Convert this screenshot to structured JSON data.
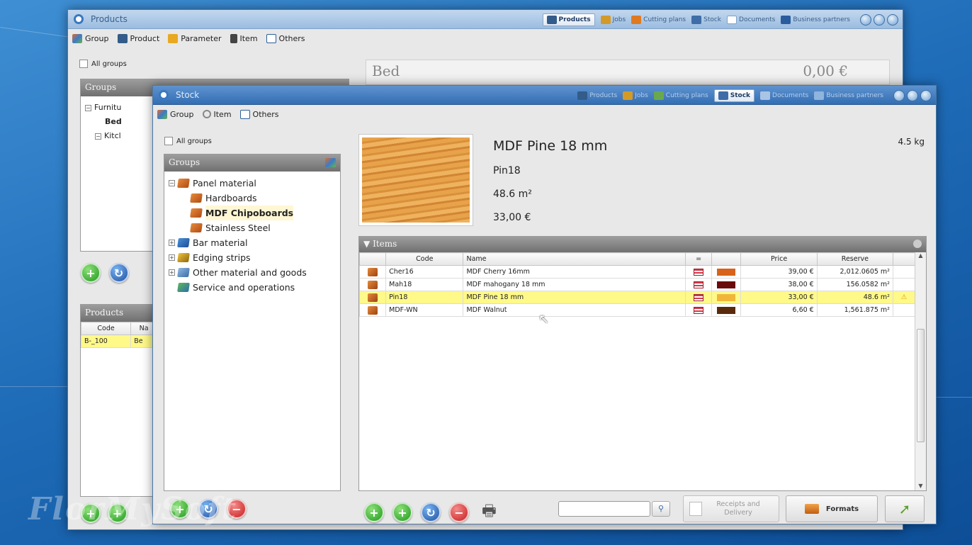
{
  "colors": {
    "accent": "#3a78c0",
    "selection": "#fff98a",
    "header_gray": "#7a7a7a"
  },
  "watermark": "FlorMySoft",
  "back_window": {
    "title": "Products",
    "nav": [
      "Products",
      "Jobs",
      "Cutting plans",
      "Stock",
      "Documents",
      "Business partners"
    ],
    "active_nav": "Products",
    "menu": [
      "Group",
      "Product",
      "Parameter",
      "Item",
      "Others"
    ],
    "all_groups": "All groups",
    "groups_header": "Groups",
    "tree": [
      "Furnitu",
      "Bed",
      "Kitcl"
    ],
    "product_name": "Bed",
    "product_price": "0,00 €",
    "products_header": "Products",
    "products_columns": [
      "Code",
      "Na"
    ],
    "products_rows": [
      [
        "B-_100",
        "Be"
      ]
    ]
  },
  "front_window": {
    "title": "Stock",
    "nav": [
      "Products",
      "Jobs",
      "Cutting plans",
      "Stock",
      "Documents",
      "Business partners"
    ],
    "active_nav": "Stock",
    "menu": [
      "Group",
      "Item",
      "Others"
    ],
    "all_groups": "All groups",
    "groups_header": "Groups",
    "tree": [
      {
        "label": "Panel material",
        "level": 0,
        "expander": "−"
      },
      {
        "label": "Hardboards",
        "level": 1,
        "expander": ""
      },
      {
        "label": "MDF Chipoboards",
        "level": 1,
        "expander": "",
        "selected": true
      },
      {
        "label": "Stainless Steel",
        "level": 1,
        "expander": ""
      },
      {
        "label": "Bar material",
        "level": 0,
        "expander": "+"
      },
      {
        "label": "Edging strips",
        "level": 0,
        "expander": "+"
      },
      {
        "label": "Other material and goods",
        "level": 0,
        "expander": "+"
      },
      {
        "label": "Service and operations",
        "level": 0,
        "expander": ""
      }
    ],
    "detail": {
      "name": "MDF Pine 18 mm",
      "code": "Pin18",
      "area": "48.6 m²",
      "price": "33,00 €",
      "weight": "4.5 kg"
    },
    "items_header": "Items",
    "columns": [
      "Code",
      "Name",
      "=",
      "",
      "Price",
      "Reserve",
      ""
    ],
    "rows": [
      {
        "code": "Cher16",
        "name": "MDF Cherry 16mm",
        "color": "#d8621a",
        "price": "39,00 €",
        "reserve": "2,012.0605 m²",
        "warn": ""
      },
      {
        "code": "Mah18",
        "name": "MDF mahogany 18 mm",
        "color": "#6b0a0a",
        "price": "38,00 €",
        "reserve": "156.0582 m²",
        "warn": ""
      },
      {
        "code": "Pin18",
        "name": "MDF Pine 18 mm",
        "color": "#f0b63a",
        "price": "33,00 €",
        "reserve": "48.6 m²",
        "warn": "⚠",
        "selected": true
      },
      {
        "code": "MDF-WN",
        "name": "MDF Walnut",
        "color": "#5a2a0c",
        "price": "6,60 €",
        "reserve": "1,561.875 m²",
        "warn": ""
      }
    ],
    "search_placeholder": "",
    "receipts_label": "Receipts and Delivery",
    "formats_label": "Formats"
  }
}
